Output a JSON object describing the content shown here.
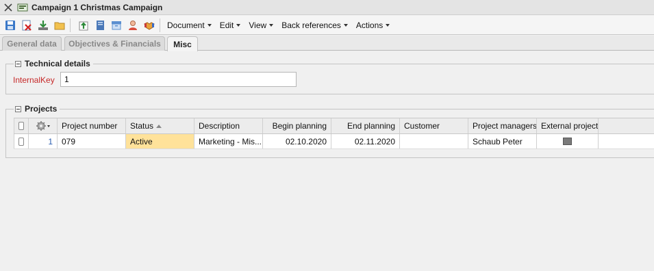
{
  "window": {
    "title": "Campaign 1 Christmas Campaign"
  },
  "toolbar": {
    "icons": [
      "save-icon",
      "delete-icon",
      "download-icon",
      "folder-icon",
      "upload-icon",
      "book-icon",
      "archive-icon",
      "person-icon",
      "handshake-icon"
    ],
    "menus": [
      {
        "label": "Document"
      },
      {
        "label": "Edit"
      },
      {
        "label": "View"
      },
      {
        "label": "Back references"
      },
      {
        "label": "Actions"
      }
    ]
  },
  "tabs": [
    {
      "label": "General data"
    },
    {
      "label": "Objectives & Financials"
    },
    {
      "label": "Misc"
    }
  ],
  "technical_details": {
    "legend": "Technical details",
    "internal_key_label": "InternalKey",
    "internal_key_value": "1"
  },
  "projects": {
    "legend": "Projects",
    "columns": {
      "project_number": "Project number",
      "status": "Status",
      "description": "Description",
      "begin_planning": "Begin planning",
      "end_planning": "End planning",
      "customer": "Customer",
      "project_managers": "Project managers",
      "external_project": "External project"
    },
    "rows": [
      {
        "row_number": "1",
        "project_number": "079",
        "status": "Active",
        "description": "Marketing - Mis...",
        "begin_planning": "02.10.2020",
        "end_planning": "02.11.2020",
        "customer": "",
        "project_managers": "Schaub Peter",
        "external_project": false
      }
    ]
  },
  "colors": {
    "required_label": "#c62828",
    "status_active_bg": "#ffe29a",
    "link": "#2a5db0"
  }
}
